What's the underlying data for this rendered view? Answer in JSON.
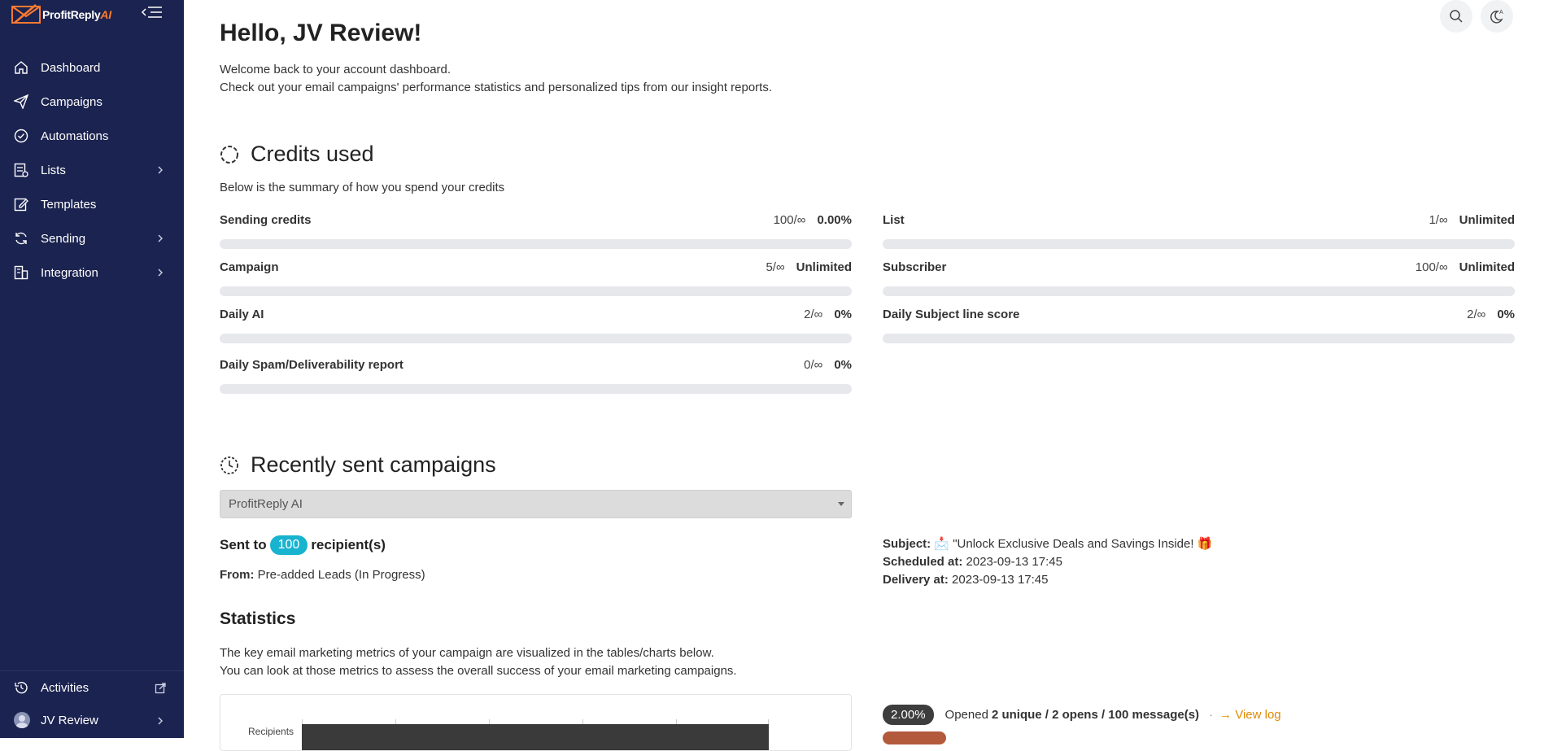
{
  "brand": {
    "name": "ProfitReply",
    "suffix": "AI"
  },
  "sidebar": {
    "items": [
      {
        "label": "Dashboard",
        "icon": "home-icon",
        "has_children": false
      },
      {
        "label": "Campaigns",
        "icon": "send-icon",
        "has_children": false
      },
      {
        "label": "Automations",
        "icon": "shield-check-icon",
        "has_children": false
      },
      {
        "label": "Lists",
        "icon": "list-icon",
        "has_children": true
      },
      {
        "label": "Templates",
        "icon": "edit-icon",
        "has_children": false
      },
      {
        "label": "Sending",
        "icon": "refresh-icon",
        "has_children": true
      },
      {
        "label": "Integration",
        "icon": "building-icon",
        "has_children": true
      }
    ],
    "bottom": {
      "activities": "Activities",
      "user": "JV Review"
    }
  },
  "header": {
    "greeting": "Hello, JV Review!",
    "welcome_line1": "Welcome back to your account dashboard.",
    "welcome_line2": "Check out your email campaigns' performance statistics and personalized tips from our insight reports."
  },
  "credits": {
    "title": "Credits used",
    "description": "Below is the summary of how you spend your credits",
    "items": [
      {
        "label": "Sending credits",
        "used": "100/∞",
        "value": "0.00%",
        "fill_fraction": 0
      },
      {
        "label": "List",
        "used": "1/∞",
        "value": "Unlimited",
        "fill_fraction": 0
      },
      {
        "label": "Campaign",
        "used": "5/∞",
        "value": "Unlimited",
        "fill_fraction": 0
      },
      {
        "label": "Subscriber",
        "used": "100/∞",
        "value": "Unlimited",
        "fill_fraction": 0
      },
      {
        "label": "Daily AI",
        "used": "2/∞",
        "value": "0%",
        "fill_fraction": 0
      },
      {
        "label": "Daily Subject line score",
        "used": "2/∞",
        "value": "0%",
        "fill_fraction": 0
      },
      {
        "label": "Daily Spam/Deliverability report",
        "used": "0/∞",
        "value": "0%",
        "fill_fraction": 0
      }
    ]
  },
  "recent": {
    "title": "Recently sent campaigns",
    "selected_campaign": "ProfitReply AI",
    "sent_prefix": "Sent to",
    "recipients": "100",
    "sent_suffix": "recipient(s)",
    "from_label": "From:",
    "from_value": "Pre-added Leads (In Progress)",
    "subject_label": "Subject:",
    "subject_value": "📩 \"Unlock Exclusive Deals and Savings Inside! 🎁",
    "scheduled_label": "Scheduled at:",
    "scheduled_value": "2023-09-13 17:45",
    "delivery_label": "Delivery at:",
    "delivery_value": "2023-09-13 17:45"
  },
  "statistics": {
    "title": "Statistics",
    "desc_line1": "The key email marketing metrics of your campaign are visualized in the tables/charts below.",
    "desc_line2": "You can look at those metrics to assess the overall success of your email marketing campaigns.",
    "chart_ylabel": "Recipients",
    "open_rate": "2.00%",
    "opened_prefix": "Opened",
    "opened_detail": "2 unique / 2 opens / 100 message(s)",
    "view_log": "→ View log"
  },
  "colors": {
    "sidebar_bg": "#1b2350",
    "accent": "#17b3cf",
    "link": "#e08a00",
    "brand_orange": "#ff7a2f"
  }
}
